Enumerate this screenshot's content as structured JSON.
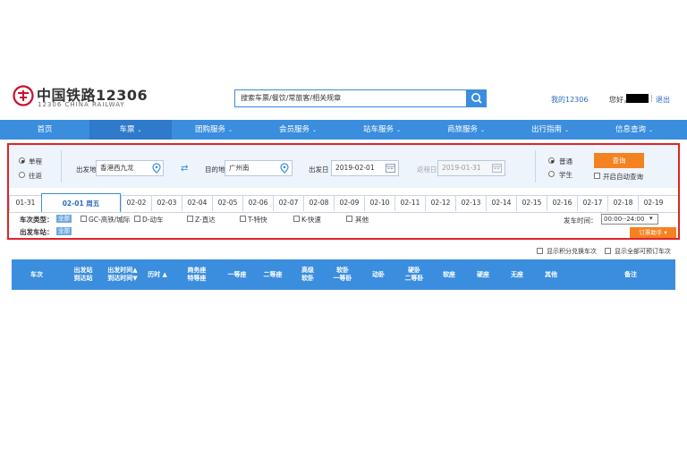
{
  "header": {
    "logo_cn": "中国铁路12306",
    "logo_en": "12306 CHINA RAILWAY",
    "search_placeholder": "搜索车票/餐饮/常旅客/相关规章",
    "my12306": "我的12306",
    "greeting": "您好，",
    "logout": "退出",
    "separator": "|"
  },
  "nav": {
    "items": [
      {
        "label": "首页",
        "caret": ""
      },
      {
        "label": "车票",
        "caret": "⌄"
      },
      {
        "label": "团购服务",
        "caret": "⌄"
      },
      {
        "label": "会员服务",
        "caret": "⌄"
      },
      {
        "label": "站车服务",
        "caret": "⌄"
      },
      {
        "label": "商旅服务",
        "caret": "⌄"
      },
      {
        "label": "出行指南",
        "caret": "⌄"
      },
      {
        "label": "信息查询",
        "caret": "⌄"
      }
    ]
  },
  "query": {
    "trip_oneway": "单程",
    "trip_round": "往返",
    "from_label": "出发地",
    "from_value": "香港西九龙",
    "to_label": "目的地",
    "to_value": "广州南",
    "depart_label": "出发日",
    "depart_value": "2019-02-01",
    "return_label": "返程日",
    "return_value": "2019-01-31",
    "ticket_normal": "普通",
    "ticket_student": "学生",
    "query_button": "查询",
    "auto_query": "开启自动查询",
    "swap_glyph": "⇄"
  },
  "dates": {
    "tabs": [
      "01-31",
      "02-01  周五",
      "02-02",
      "02-03",
      "02-04",
      "02-05",
      "02-06",
      "02-07",
      "02-08",
      "02-09",
      "02-10",
      "02-11",
      "02-12",
      "02-13",
      "02-14",
      "02-15",
      "02-16",
      "02-17",
      "02-18",
      "02-19"
    ],
    "active_index": 1
  },
  "filters": {
    "train_type_label": "车次类型：",
    "all": "全部",
    "types": [
      "GC-高铁/城际",
      "D-动车",
      "Z-直达",
      "T-特快",
      "K-快速",
      "其他"
    ],
    "station_label": "出发车站：",
    "depart_time_label": "发车时间：",
    "depart_time_value": "00:00--24:00",
    "assist_button": "订票助手",
    "show_points": "显示积分兑换车次",
    "show_all": "显示全部可预订车次"
  },
  "table": {
    "headers": [
      {
        "l1": "车次",
        "l2": ""
      },
      {
        "l1": "出发站",
        "l2": "到达站"
      },
      {
        "l1": "出发时间▲",
        "l2": "到达时间▼"
      },
      {
        "l1": "历时 ▲",
        "l2": ""
      },
      {
        "l1": "商务座",
        "l2": "特等座"
      },
      {
        "l1": "一等座",
        "l2": ""
      },
      {
        "l1": "二等座",
        "l2": ""
      },
      {
        "l1": "高级",
        "l2": "软卧"
      },
      {
        "l1": "软卧",
        "l2": "一等卧"
      },
      {
        "l1": "动卧",
        "l2": ""
      },
      {
        "l1": "硬卧",
        "l2": "二等卧"
      },
      {
        "l1": "软座",
        "l2": ""
      },
      {
        "l1": "硬座",
        "l2": ""
      },
      {
        "l1": "无座",
        "l2": ""
      },
      {
        "l1": "其他",
        "l2": ""
      },
      {
        "l1": "备注",
        "l2": ""
      }
    ]
  },
  "colors": {
    "brand_blue": "#3b8ddd",
    "accent_orange": "#f58220",
    "frame_red": "#e0232b",
    "logo_red": "#c8102e"
  }
}
